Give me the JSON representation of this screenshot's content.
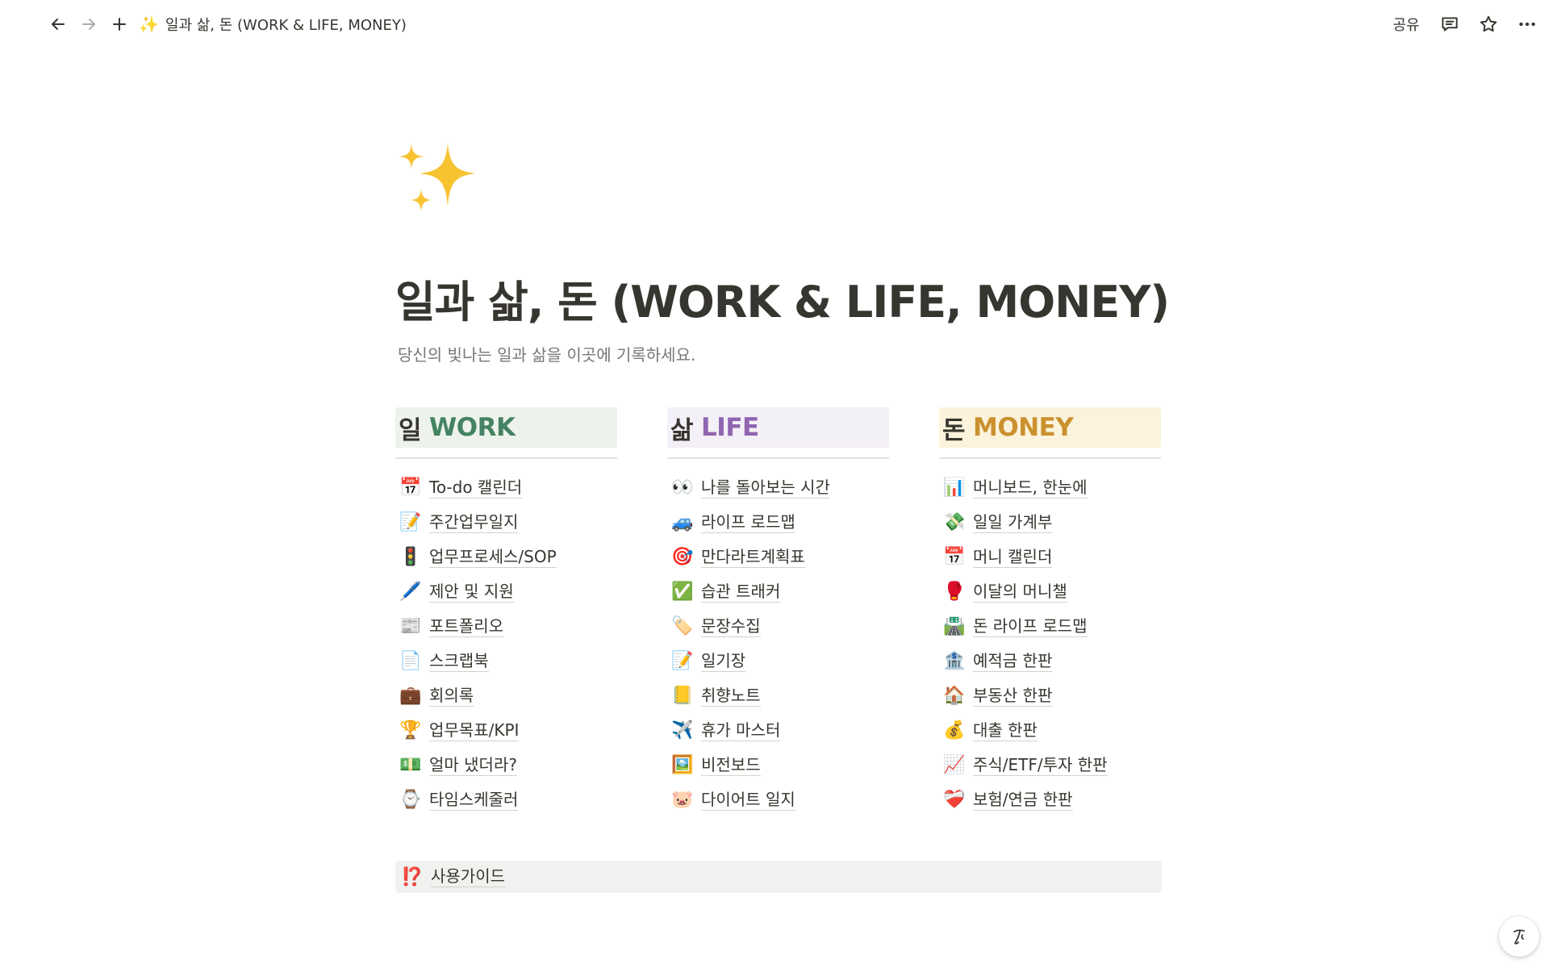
{
  "topbar": {
    "breadcrumb_icon": "✨",
    "breadcrumb_title": "일과 삶, 돈 (WORK & LIFE, MONEY)",
    "share_label": "공유",
    "icons": [
      "back-arrow-icon",
      "forward-arrow-icon",
      "plus-icon",
      "comment-icon",
      "star-icon",
      "more-icon"
    ]
  },
  "page": {
    "icon": "✨",
    "title": "일과 삶, 돈 (WORK & LIFE, MONEY)",
    "description": "당신의 빛나는 일과 삶을 이곳에 기록하세요."
  },
  "columns": {
    "work": {
      "head_ko": "일",
      "head_en": "WORK",
      "accent": "#448361",
      "bg": "#edf3ec",
      "items": [
        {
          "icon": "📅",
          "label": "To-do 캘린더"
        },
        {
          "icon": "📝",
          "label": "주간업무일지"
        },
        {
          "icon": "🚦",
          "label": "업무프로세스/SOP"
        },
        {
          "icon": "🖊️",
          "label": "제안 및 지원"
        },
        {
          "icon": "📰",
          "label": "포트폴리오"
        },
        {
          "icon": "📄",
          "label": "스크랩북"
        },
        {
          "icon": "💼",
          "label": "회의록"
        },
        {
          "icon": "🏆",
          "label": "업무목표/KPI"
        },
        {
          "icon": "💵",
          "label": "얼마 냈더라?"
        },
        {
          "icon": "⌚",
          "label": "타임스케줄러"
        }
      ]
    },
    "life": {
      "head_ko": "삶",
      "head_en": "LIFE",
      "accent": "#9065b0",
      "bg": "#f4f0f7",
      "items": [
        {
          "icon": "👀",
          "label": "나를 돌아보는 시간"
        },
        {
          "icon": "🚙",
          "label": "라이프 로드맵"
        },
        {
          "icon": "🎯",
          "label": "만다라트계획표"
        },
        {
          "icon": "✅",
          "label": "습관 트래커"
        },
        {
          "icon": "🏷️",
          "label": "문장수집"
        },
        {
          "icon": "📝",
          "label": "일기장"
        },
        {
          "icon": "📒",
          "label": "취향노트"
        },
        {
          "icon": "✈️",
          "label": "휴가 마스터"
        },
        {
          "icon": "🖼️",
          "label": "비전보드"
        },
        {
          "icon": "🐷",
          "label": "다이어트 일지"
        }
      ]
    },
    "money": {
      "head_ko": "돈",
      "head_en": "MONEY",
      "accent": "#cb912f",
      "bg": "#fbf3db",
      "items": [
        {
          "icon": "📊",
          "label": "머니보드, 한눈에"
        },
        {
          "icon": "💸",
          "label": "일일 가계부"
        },
        {
          "icon": "📅",
          "label": "머니 캘린더"
        },
        {
          "icon": "🥊",
          "label": "이달의 머니챌"
        },
        {
          "icon": "🛣️",
          "label": "돈 라이프 로드맵"
        },
        {
          "icon": "🏦",
          "label": "예적금 한판"
        },
        {
          "icon": "🏠",
          "label": "부동산 한판"
        },
        {
          "icon": "💰",
          "label": "대출 한판"
        },
        {
          "icon": "📈",
          "label": "주식/ETF/투자 한판"
        },
        {
          "icon": "❤️‍🩹",
          "label": "보험/연금 한판"
        }
      ]
    }
  },
  "guide": {
    "icon": "⁉️",
    "label": "사용가이드"
  },
  "help_button_icon": "notion-ai-icon"
}
